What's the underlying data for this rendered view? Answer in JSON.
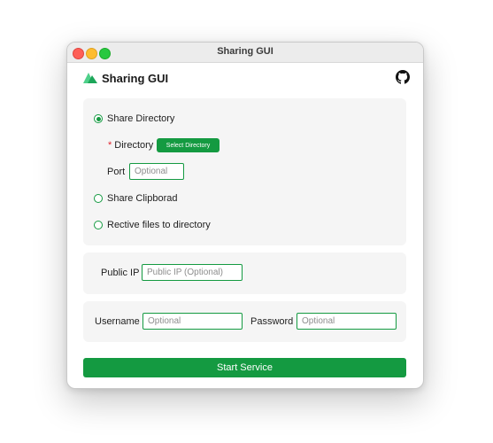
{
  "window": {
    "title": "Sharing GUI"
  },
  "header": {
    "app_title": "Sharing GUI",
    "logo_icon": "mountain-logo-icon",
    "github_icon": "github-icon"
  },
  "share_options": {
    "share_directory": "Share Directory",
    "directory_required_mark": "*",
    "directory_label": "Directory",
    "select_directory_button": "Select Directory",
    "port_label": "Port",
    "port_placeholder": "Optional",
    "share_clipboard": "Share Clipborad",
    "receive_files": "Rective files to directory",
    "selected": "share_directory"
  },
  "public_ip": {
    "label": "Public IP",
    "placeholder": "Public IP (Optional)"
  },
  "auth": {
    "username_label": "Username",
    "username_placeholder": "Optional",
    "password_label": "Password",
    "password_placeholder": "Optional"
  },
  "start_button": "Start Service",
  "colors": {
    "accent": "#149a41",
    "panel_bg": "#f5f5f5",
    "required": "#e0242e"
  }
}
